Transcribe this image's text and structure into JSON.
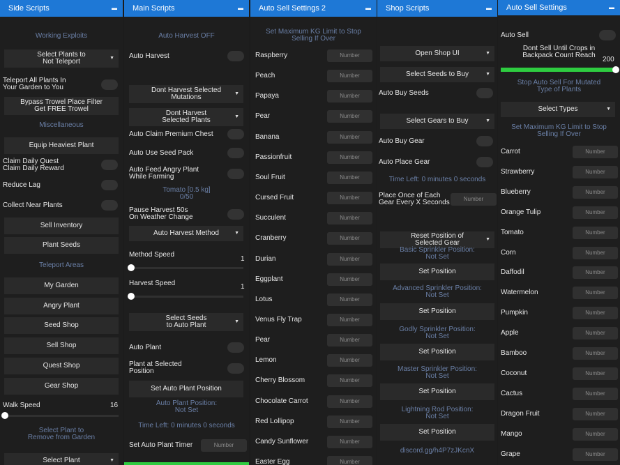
{
  "col1": {
    "title": "Side Scripts",
    "working_exploits": "Working Exploits",
    "select_plants_dd": "Select Plants to\nNot Teleport",
    "teleport_all": "Teleport All Plants In\nYour Garden to You",
    "bypass_trowel": "Bypass Trowel Place Filter\nGet FREE Trowel",
    "misc": "Miscellaneous",
    "equip_heaviest": "Equip Heaviest Plant",
    "claim_daily": "Claim Daily Quest\nClaim Daily Reward",
    "reduce_lag": "Reduce Lag",
    "collect_near": "Collect Near Plants",
    "sell_inventory": "Sell Inventory",
    "plant_seeds": "Plant Seeds",
    "teleport_areas": "Teleport Areas",
    "my_garden": "My Garden",
    "angry_plant": "Angry Plant",
    "seed_shop": "Seed Shop",
    "sell_shop": "Sell Shop",
    "quest_shop": "Quest Shop",
    "gear_shop": "Gear Shop",
    "walk_speed": "Walk Speed",
    "walk_speed_value": "16",
    "select_remove": "Select Plant to\nRemove from Garden",
    "select_plant_dd": "Select Plant"
  },
  "col2": {
    "title": "Main Scripts",
    "auto_harvest_status": "Auto Harvest OFF",
    "auto_harvest": "Auto Harvest",
    "dont_harvest_mut": "Dont Harvest Selected\nMutations",
    "dont_harvest_plants": "Dont Harvest\nSelected Plants",
    "auto_claim_chest": "Auto Claim Premium Chest",
    "auto_use_seed": "Auto Use Seed Pack",
    "auto_feed": "Auto Feed Angry Plant\nWhile Farming",
    "tomato_info": "Tomato [0.5 kg]\n0/50",
    "pause_harvest": "Pause Harvest 50s\nOn Weather Change",
    "harvest_method": "Auto Harvest Method",
    "method_speed": "Method Speed",
    "method_speed_value": "1",
    "harvest_speed": "Harvest Speed",
    "harvest_speed_value": "1",
    "select_seeds_auto": "Select Seeds\nto Auto Plant",
    "auto_plant": "Auto Plant",
    "plant_at_selected": "Plant at Selected\nPosition",
    "set_auto_plant_pos": "Set Auto Plant Position",
    "auto_plant_pos": "Auto Plant Position:\nNot Set",
    "time_left": "Time Left: 0 minutes 0 seconds",
    "set_auto_plant_timer": "Set Auto Plant Timer",
    "number_placeholder": "Number"
  },
  "col3": {
    "title": "Auto Sell Settings 2",
    "max_kg": "Set Maximum KG Limit to Stop\nSelling If Over",
    "number_placeholder": "Number",
    "plants": [
      "Raspberry",
      "Peach",
      "Papaya",
      "Pear",
      "Banana",
      "Passionfruit",
      "Soul Fruit",
      "Cursed Fruit",
      "Succulent",
      "Cranberry",
      "Durian",
      "Eggplant",
      "Lotus",
      "Venus Fly Trap",
      "Pear",
      "Lemon",
      "Cherry Blossom",
      "Chocolate Carrot",
      "Red Lollipop",
      "Candy Sunflower",
      "Easter Egg"
    ]
  },
  "col4": {
    "title": "Shop Scripts",
    "open_shop": "Open Shop UI",
    "select_seeds_buy": "Select Seeds to Buy",
    "auto_buy_seeds": "Auto Buy Seeds",
    "select_gears_buy": "Select Gears to Buy",
    "auto_buy_gear": "Auto Buy Gear",
    "auto_place_gear": "Auto Place Gear",
    "time_left": "Time Left: 0 minutes 0 seconds",
    "place_once": "Place Once of Each\nGear Every X Seconds",
    "number_placeholder": "Number",
    "reset_position": "Reset Position of\nSelected Gear",
    "basic_sprinkler": "Basic Sprinkler Position:\nNot Set",
    "advanced_sprinkler": "Advanced Sprinkler Position:\nNot Set",
    "godly_sprinkler": "Godly Sprinkler Position:\nNot Set",
    "master_sprinkler": "Master Sprinkler Position:\nNot Set",
    "lightning_rod": "Lightning Rod Position:\nNot Set",
    "set_position": "Set Position",
    "discord": "discord.gg/h4P7zJKcnX"
  },
  "col5": {
    "title": "Auto Sell Settings",
    "auto_sell": "Auto Sell",
    "dont_sell_until": "Dont Sell Until Crops in\nBackpack Count Reach",
    "count_value": "200",
    "stop_mutated": "Stop Auto Sell For Mutated\nType of Plants",
    "select_types": "Select Types",
    "max_kg": "Set Maximum KG Limit to Stop\nSelling If Over",
    "number_placeholder": "Number",
    "plants": [
      "Carrot",
      "Strawberry",
      "Blueberry",
      "Orange Tulip",
      "Tomato",
      "Corn",
      "Daffodil",
      "Watermelon",
      "Pumpkin",
      "Apple",
      "Bamboo",
      "Coconut",
      "Cactus",
      "Dragon Fruit",
      "Mango",
      "Grape"
    ]
  },
  "colors": {
    "header": "#1e78d6",
    "section": "#6a7fa6",
    "progress": "#2ecc40"
  },
  "icons": {
    "caret": "caret-down-icon",
    "arrow": "dropdown-arrow-icon"
  }
}
